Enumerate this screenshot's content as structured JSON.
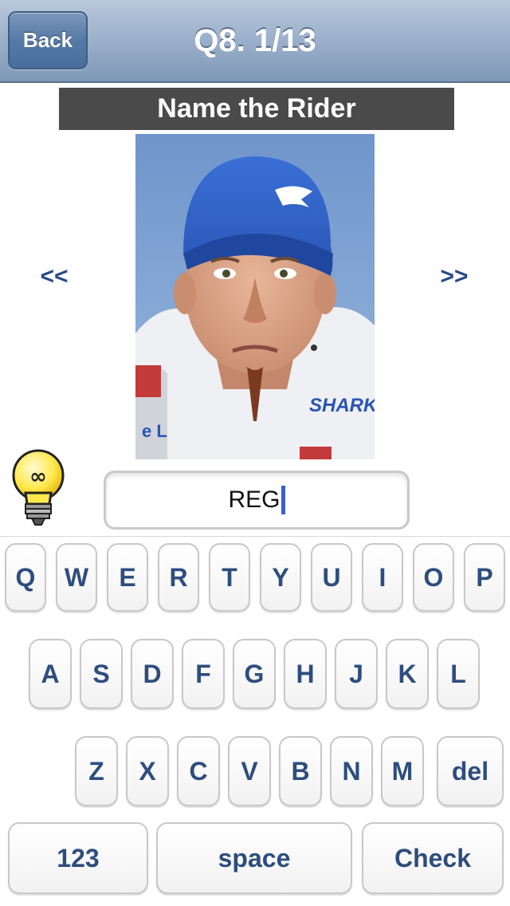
{
  "nav": {
    "back_label": "Back",
    "title": "Q8. 1/13"
  },
  "question": {
    "prompt": "Name the Rider"
  },
  "navigation": {
    "prev": "<<",
    "next": ">>"
  },
  "answer": {
    "value": "REG"
  },
  "hint": {
    "icon": "lightbulb-icon",
    "symbol": "∞"
  },
  "keyboard": {
    "row1": [
      "Q",
      "W",
      "E",
      "R",
      "T",
      "Y",
      "U",
      "I",
      "O",
      "P"
    ],
    "row2": [
      "A",
      "S",
      "D",
      "F",
      "G",
      "H",
      "J",
      "K",
      "L"
    ],
    "row3": [
      "Z",
      "X",
      "C",
      "V",
      "B",
      "N",
      "M"
    ],
    "delete_label": "del",
    "numbers_label": "123",
    "space_label": "space",
    "check_label": "Check"
  },
  "colors": {
    "nav_bar": "#9db2cc",
    "key_text": "#2e4d7e",
    "banner": "#4a4a4a",
    "caret": "#3a5fcd"
  }
}
